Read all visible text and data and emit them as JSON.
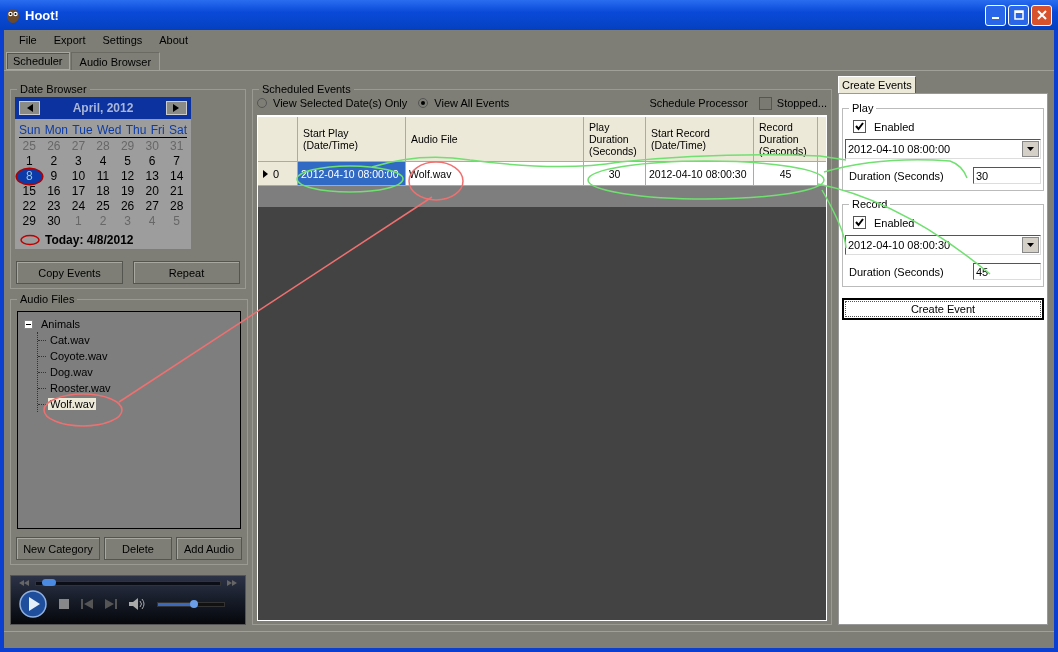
{
  "window": {
    "title": "Hoot!"
  },
  "menu": [
    "File",
    "Export",
    "Settings",
    "About"
  ],
  "tabs": [
    {
      "label": "Scheduler",
      "selected": true
    },
    {
      "label": "Audio Browser",
      "selected": false
    }
  ],
  "date_browser": {
    "title": "Date Browser",
    "month": "April, 2012",
    "day_names": [
      "Sun",
      "Mon",
      "Tue",
      "Wed",
      "Thu",
      "Fri",
      "Sat"
    ],
    "weeks": [
      [
        {
          "label": "25",
          "other_month": true,
          "selected": false
        },
        {
          "label": "26",
          "other_month": true,
          "selected": false
        },
        {
          "label": "27",
          "other_month": true,
          "selected": false
        },
        {
          "label": "28",
          "other_month": true,
          "selected": false
        },
        {
          "label": "29",
          "other_month": true,
          "selected": false
        },
        {
          "label": "30",
          "other_month": true,
          "selected": false
        },
        {
          "label": "31",
          "other_month": true,
          "selected": false
        }
      ],
      [
        {
          "label": "1",
          "other_month": false,
          "selected": false
        },
        {
          "label": "2",
          "other_month": false,
          "selected": false
        },
        {
          "label": "3",
          "other_month": false,
          "selected": false
        },
        {
          "label": "4",
          "other_month": false,
          "selected": false
        },
        {
          "label": "5",
          "other_month": false,
          "selected": false
        },
        {
          "label": "6",
          "other_month": false,
          "selected": false
        },
        {
          "label": "7",
          "other_month": false,
          "selected": false
        }
      ],
      [
        {
          "label": "8",
          "other_month": false,
          "selected": true
        },
        {
          "label": "9",
          "other_month": false,
          "selected": false
        },
        {
          "label": "10",
          "other_month": false,
          "selected": false
        },
        {
          "label": "11",
          "other_month": false,
          "selected": false
        },
        {
          "label": "12",
          "other_month": false,
          "selected": false
        },
        {
          "label": "13",
          "other_month": false,
          "selected": false
        },
        {
          "label": "14",
          "other_month": false,
          "selected": false
        }
      ],
      [
        {
          "label": "15",
          "other_month": false,
          "selected": false
        },
        {
          "label": "16",
          "other_month": false,
          "selected": false
        },
        {
          "label": "17",
          "other_month": false,
          "selected": false
        },
        {
          "label": "18",
          "other_month": false,
          "selected": false
        },
        {
          "label": "19",
          "other_month": false,
          "selected": false
        },
        {
          "label": "20",
          "other_month": false,
          "selected": false
        },
        {
          "label": "21",
          "other_month": false,
          "selected": false
        }
      ],
      [
        {
          "label": "22",
          "other_month": false,
          "selected": false
        },
        {
          "label": "23",
          "other_month": false,
          "selected": false
        },
        {
          "label": "24",
          "other_month": false,
          "selected": false
        },
        {
          "label": "25",
          "other_month": false,
          "selected": false
        },
        {
          "label": "26",
          "other_month": false,
          "selected": false
        },
        {
          "label": "27",
          "other_month": false,
          "selected": false
        },
        {
          "label": "28",
          "other_month": false,
          "selected": false
        }
      ],
      [
        {
          "label": "29",
          "other_month": false,
          "selected": false
        },
        {
          "label": "30",
          "other_month": false,
          "selected": false
        },
        {
          "label": "1",
          "other_month": true,
          "selected": false
        },
        {
          "label": "2",
          "other_month": true,
          "selected": false
        },
        {
          "label": "3",
          "other_month": true,
          "selected": false
        },
        {
          "label": "4",
          "other_month": true,
          "selected": false
        },
        {
          "label": "5",
          "other_month": true,
          "selected": false
        }
      ]
    ],
    "today": "Today: 4/8/2012",
    "buttons": [
      "Copy Events",
      "Repeat"
    ]
  },
  "audio_files": {
    "title": "Audio Files",
    "tree": [
      {
        "label": "Animals",
        "expanded": true,
        "selected": false,
        "children": [
          {
            "label": "Cat.wav",
            "selected": false
          },
          {
            "label": "Coyote.wav",
            "selected": false
          },
          {
            "label": "Dog.wav",
            "selected": false
          },
          {
            "label": "Rooster.wav",
            "selected": false
          },
          {
            "label": "Wolf.wav",
            "selected": true
          }
        ]
      }
    ],
    "buttons": [
      "New Category",
      "Delete",
      "Add Audio"
    ]
  },
  "player": {
    "progress": {
      "level": 0.03
    },
    "volume": {
      "level": 0.55
    }
  },
  "scheduled_events": {
    "title": "Scheduled Events",
    "filters": [
      {
        "label": "View Selected Date(s) Only",
        "selected": false
      },
      {
        "label": "View All Events",
        "selected": true
      }
    ],
    "processor_label": "Schedule Processor",
    "processor": {
      "label": "Stopped...",
      "checked": false
    },
    "columns": [
      "Start Play\n(Date/Time)",
      "Audio File",
      "Play\nDuration\n(Seconds)",
      "Start Record\n(Date/Time)",
      "Record\nDuration\n(Seconds)"
    ],
    "rows": [
      {
        "index": "0",
        "current": true,
        "cells": [
          {
            "text": "2012-04-10 08:00:00",
            "selected": true
          },
          {
            "text": "Wolf.wav",
            "selected": false
          },
          {
            "text": "30",
            "selected": false
          },
          {
            "text": "2012-04-10 08:00:30",
            "selected": false
          },
          {
            "text": "45",
            "selected": false
          }
        ]
      }
    ]
  },
  "create_events": {
    "tab": "Create Events",
    "groups": [
      {
        "title": "Play",
        "enabled_label": "Enabled",
        "enabled": true,
        "datetime": "2012-04-10 08:00:00",
        "duration_label": "Duration (Seconds)",
        "duration": "30"
      },
      {
        "title": "Record",
        "enabled_label": "Enabled",
        "enabled": true,
        "datetime": "2012-04-10 08:00:30",
        "duration_label": "Duration (Seconds)",
        "duration": "45"
      }
    ],
    "button": "Create Event"
  }
}
